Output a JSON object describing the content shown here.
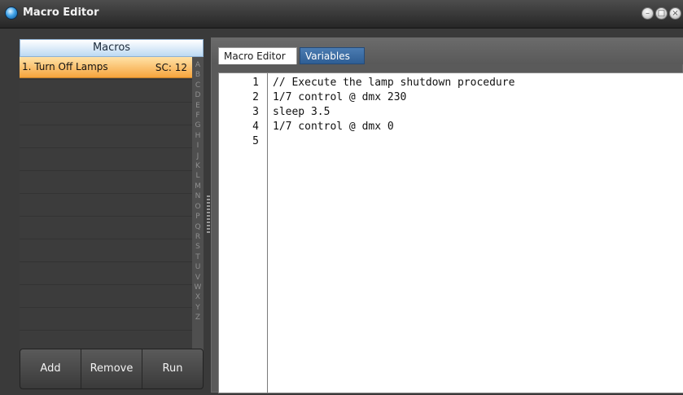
{
  "window": {
    "title": "Macro Editor"
  },
  "left_panel": {
    "header": "Macros",
    "macros": [
      {
        "name": "1. Turn Off Lamps",
        "sc": "SC: 12"
      }
    ],
    "alphabet": [
      "A",
      "B",
      "C",
      "D",
      "E",
      "F",
      "G",
      "H",
      "I",
      "J",
      "K",
      "L",
      "M",
      "N",
      "O",
      "P",
      "Q",
      "R",
      "S",
      "T",
      "U",
      "V",
      "W",
      "X",
      "Y",
      "Z"
    ],
    "buttons": {
      "add": "Add",
      "remove": "Remove",
      "run": "Run"
    }
  },
  "tabs": [
    {
      "label": "Macro Editor",
      "active": true
    },
    {
      "label": "Variables",
      "active": false
    }
  ],
  "editor": {
    "lines": [
      {
        "num": "1",
        "text": "// Execute the lamp shutdown procedure"
      },
      {
        "num": "2",
        "text": "1/7 control @ dmx 230"
      },
      {
        "num": "3",
        "text": "sleep 3.5"
      },
      {
        "num": "4",
        "text": "1/7 control @ dmx 0"
      },
      {
        "num": "5",
        "text": ""
      }
    ]
  },
  "colors": {
    "selected_row": "#f6a43d",
    "tab_inactive": "#2f5e94",
    "header": "#bcd9f3"
  }
}
